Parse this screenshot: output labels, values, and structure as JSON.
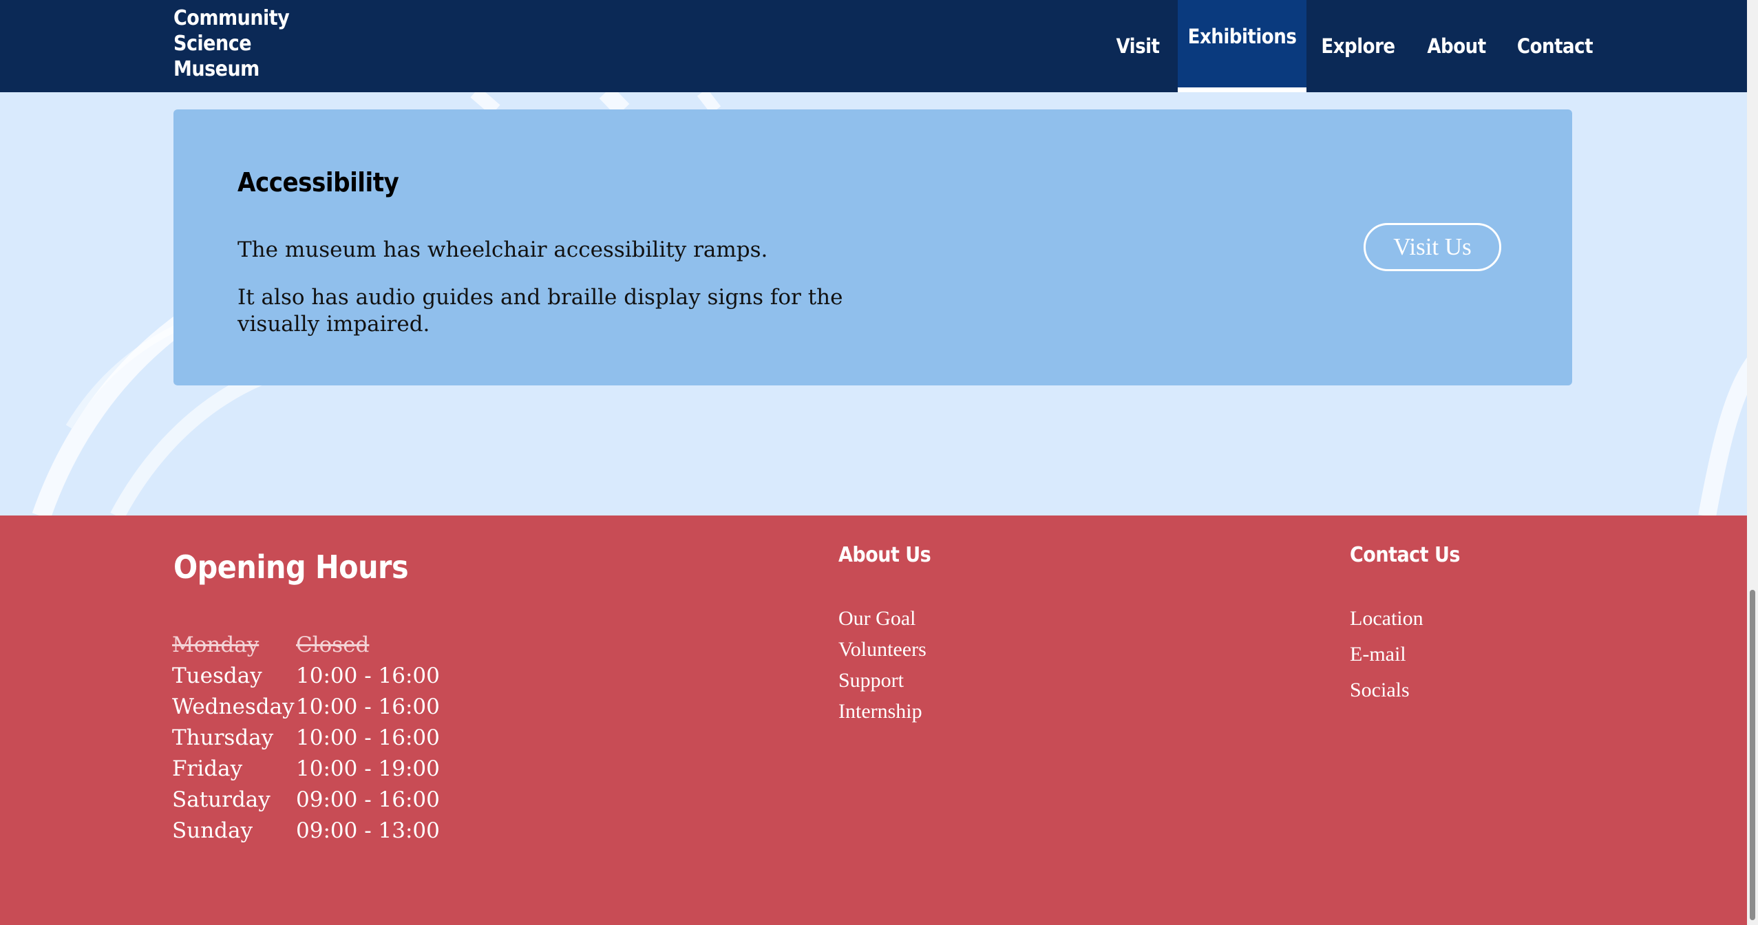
{
  "brand": {
    "line1": "Community",
    "line2": "Science",
    "line3": "Museum"
  },
  "nav": {
    "items": [
      {
        "label": "Visit",
        "active": false
      },
      {
        "label": "Exhibitions",
        "active": true
      },
      {
        "label": "Explore",
        "active": false
      },
      {
        "label": "About",
        "active": false
      },
      {
        "label": "Contact",
        "active": false
      }
    ]
  },
  "accessibility": {
    "title": "Accessibility",
    "paragraph1": "The museum has wheelchair accessibility ramps.",
    "paragraph2": "It also has audio guides and braille display signs for the visually impaired.",
    "button_label": "Visit Us"
  },
  "footer": {
    "hours_title": "Opening Hours",
    "hours": [
      {
        "day": "Monday",
        "time": "Closed",
        "closed": true
      },
      {
        "day": "Tuesday",
        "time": "10:00 - 16:00",
        "closed": false
      },
      {
        "day": "Wednesday",
        "time": "10:00 - 16:00",
        "closed": false
      },
      {
        "day": "Thursday",
        "time": "10:00 - 16:00",
        "closed": false
      },
      {
        "day": "Friday",
        "time": "10:00 - 19:00",
        "closed": false
      },
      {
        "day": "Saturday",
        "time": "09:00 - 16:00",
        "closed": false
      },
      {
        "day": "Sunday",
        "time": "09:00 - 13:00",
        "closed": false
      }
    ],
    "about": {
      "title": "About Us",
      "links": [
        "Our Goal",
        "Volunteers",
        "Support",
        "Internship"
      ]
    },
    "contact": {
      "title": "Contact Us",
      "links": [
        "Location",
        "E-mail",
        "Socials"
      ]
    }
  },
  "colors": {
    "header_bg": "#0b2956",
    "nav_active_bg": "#0a3a7e",
    "page_bg": "#d9eafd",
    "card_bg": "#90bfec",
    "footer_bg": "#c84c55"
  }
}
